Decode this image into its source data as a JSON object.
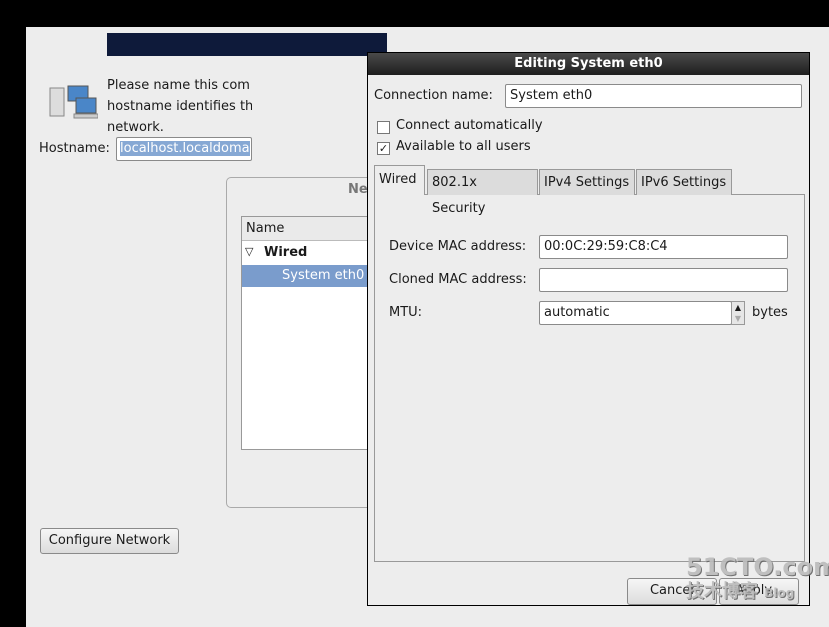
{
  "installer": {
    "description_lines": [
      "Please name this com",
      "hostname identifies th",
      "network."
    ],
    "hostname_label": "Hostname:",
    "hostname_value": "localhost.localdoma",
    "network_panel_title": "Ne",
    "list_header": "Name",
    "group": "Wired",
    "selected_connection": "System eth0",
    "configure_button": "Configure Network"
  },
  "dialog": {
    "title": "Editing System eth0",
    "connection_name_label": "Connection name:",
    "connection_name_value": "System eth0",
    "connect_automatically": "Connect automatically",
    "connect_automatically_checked": false,
    "available_all_users": "Available to all users",
    "available_all_users_checked": true,
    "check_mark": "✓",
    "tabs": [
      {
        "label": "Wired",
        "active": true
      },
      {
        "label": "802.1x Security"
      },
      {
        "label": "IPv4 Settings"
      },
      {
        "label": "IPv6 Settings"
      }
    ],
    "device_mac_label": "Device MAC address:",
    "device_mac_value": "00:0C:29:59:C8:C4",
    "cloned_mac_label": "Cloned MAC address:",
    "cloned_mac_value": "",
    "mtu_label": "MTU:",
    "mtu_value": "automatic",
    "mtu_unit": "bytes",
    "cancel": "Cancel",
    "apply": "Apply..."
  },
  "watermark": {
    "line1": "51CTO.com",
    "line2": "技术博客",
    "line3": "Blog"
  }
}
